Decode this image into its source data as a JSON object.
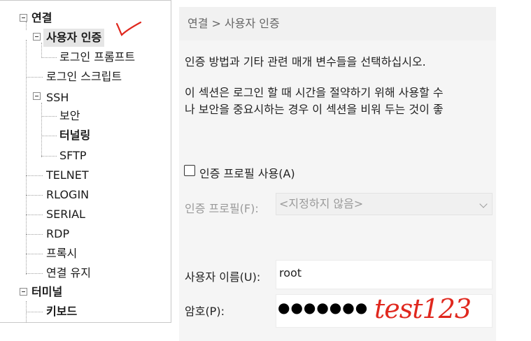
{
  "tree": {
    "items": [
      {
        "label": "연결",
        "bold": true
      },
      {
        "label": "사용자 인증",
        "bold": true,
        "selected": true
      },
      {
        "label": "로그인 프롬프트"
      },
      {
        "label": "로그인 스크립트"
      },
      {
        "label": "SSH"
      },
      {
        "label": "보안"
      },
      {
        "label": "터널링",
        "bold": true
      },
      {
        "label": "SFTP"
      },
      {
        "label": "TELNET"
      },
      {
        "label": "RLOGIN"
      },
      {
        "label": "SERIAL"
      },
      {
        "label": "RDP"
      },
      {
        "label": "프록시"
      },
      {
        "label": "연결 유지"
      },
      {
        "label": "터미널",
        "bold": true
      },
      {
        "label": "키보드",
        "bold": true
      }
    ]
  },
  "header": {
    "breadcrumb": "연결 > 사용자 인증"
  },
  "content": {
    "description": "인증 방법과 기타 관련 매개 변수들을 선택하십시오.",
    "info_line1": "이 섹션은 로그인 할 때 시간을 절약하기 위해 사용할 수",
    "info_line2": "나 보안을 중요시하는 경우 이 섹션을 비워 두는 것이 좋",
    "use_profile_label": "인증 프로필 사용(A)",
    "use_profile_checked": false,
    "profile_label": "인증 프로필(F):",
    "profile_value": "<지정하지 않음>",
    "username_label": "사용자 이름(U):",
    "username_value": "root",
    "password_label": "암호(P):",
    "password_value": "●●●●●●●"
  },
  "annotations": {
    "password_note": "test123",
    "color": "#e0281e"
  }
}
